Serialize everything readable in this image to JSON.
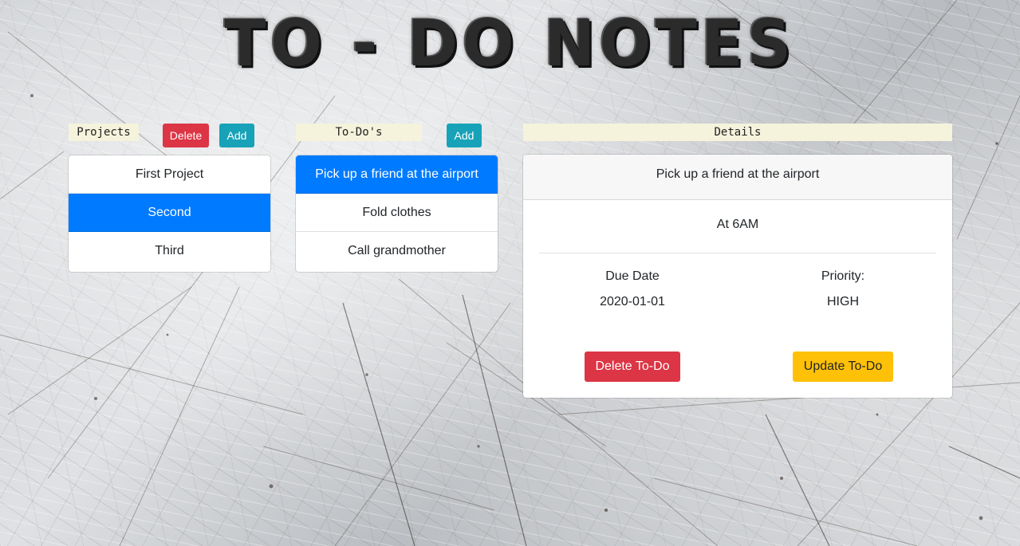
{
  "app": {
    "title": "TO - DO NOTES"
  },
  "projects": {
    "label": "Projects",
    "delete_label": "Delete",
    "add_label": "Add",
    "items": [
      {
        "label": "First Project",
        "active": false
      },
      {
        "label": "Second",
        "active": true
      },
      {
        "label": "Third",
        "active": false
      }
    ]
  },
  "todos": {
    "label": "To-Do's",
    "add_label": "Add",
    "items": [
      {
        "label": "Pick up a friend at the airport",
        "active": true
      },
      {
        "label": "Fold clothes",
        "active": false
      },
      {
        "label": "Call grandmother",
        "active": false
      }
    ]
  },
  "details": {
    "label": "Details",
    "title": "Pick up a friend at the airport",
    "description": "At 6AM",
    "due_date_label": "Due Date",
    "due_date_value": "2020-01-01",
    "priority_label": "Priority:",
    "priority_value": "HIGH",
    "delete_label": "Delete To-Do",
    "update_label": "Update To-Do"
  },
  "colors": {
    "primary": "#007bff",
    "danger": "#dc3545",
    "info": "#17a2b8",
    "warning": "#ffc107",
    "label_bg": "#f5f3dc"
  }
}
